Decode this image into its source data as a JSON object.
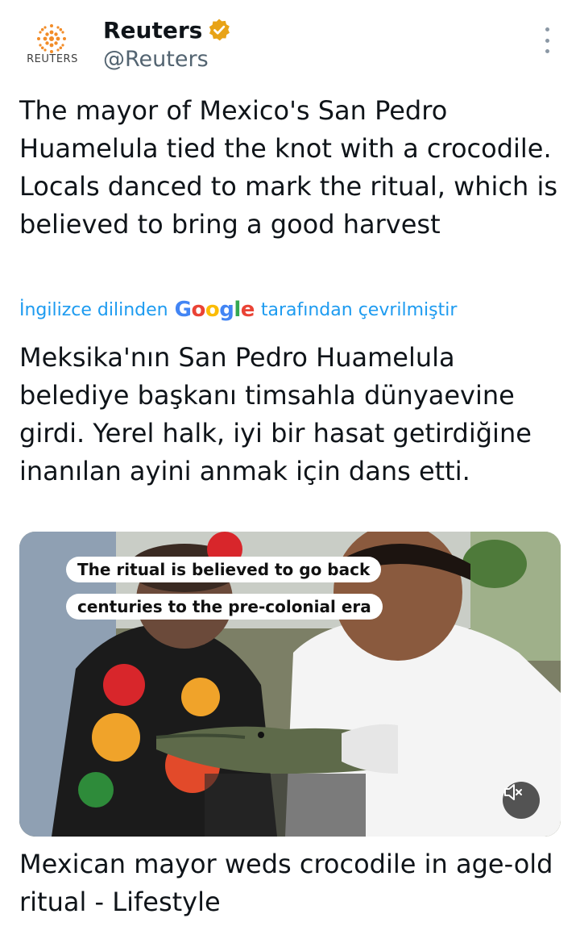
{
  "author": {
    "logo_text": "REUTERS",
    "name": "Reuters",
    "handle": "@Reuters",
    "verified_color": "#e8a317"
  },
  "tweet": {
    "text": "The mayor of Mexico's San Pedro Huamelula tied the knot with a crocodile. Locals danced to mark the ritual, which is believed to bring a good harvest"
  },
  "translation": {
    "prefix": "İngilizce dilinden",
    "google": [
      "G",
      "o",
      "o",
      "g",
      "l",
      "e"
    ],
    "google_colors": [
      "#4285f4",
      "#ea4335",
      "#fbbc05",
      "#4285f4",
      "#34a853",
      "#ea4335"
    ],
    "suffix": "tarafından çevrilmiştir",
    "text": "Meksika'nın San Pedro Huamelula belediye başkanı timsahla dünyaevine girdi. Yerel halk, iyi bir hasat getirdiğine inanılan ayini anmak için dans etti."
  },
  "media": {
    "caption_line1": "The ritual is believed to go back",
    "caption_line2": "centuries to the pre-colonial era",
    "mute_icon": "speaker-muted-icon"
  },
  "link_card": {
    "title": "Mexican mayor weds crocodile in age-old ritual - Lifestyle"
  }
}
